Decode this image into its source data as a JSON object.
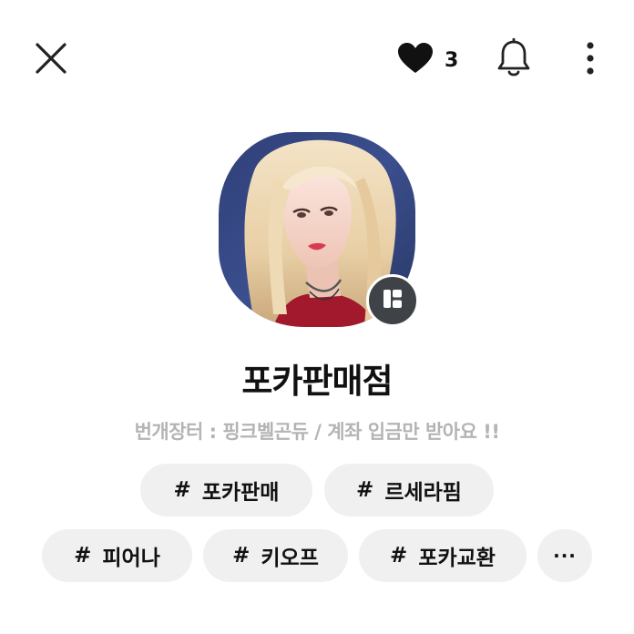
{
  "header": {
    "close_icon": "close-icon",
    "like_icon": "heart-icon",
    "like_count": "3",
    "bell_icon": "bell-icon",
    "more_icon": "more-vertical-icon"
  },
  "profile": {
    "shop_name": "포카판매점",
    "description": "번개장터 : 핑크벨곤듀 / 계좌 입금만 받아요 !!",
    "badge_icon": "shop-badge-icon"
  },
  "tags": {
    "hash": "#",
    "items": [
      "포카판매",
      "르세라핌",
      "피어나",
      "키오프",
      "포카교환"
    ],
    "more_label": "···"
  },
  "colors": {
    "tag_bg": "#f0f0f0",
    "description": "#b4b4b4",
    "badge_bg": "#3f4246"
  }
}
